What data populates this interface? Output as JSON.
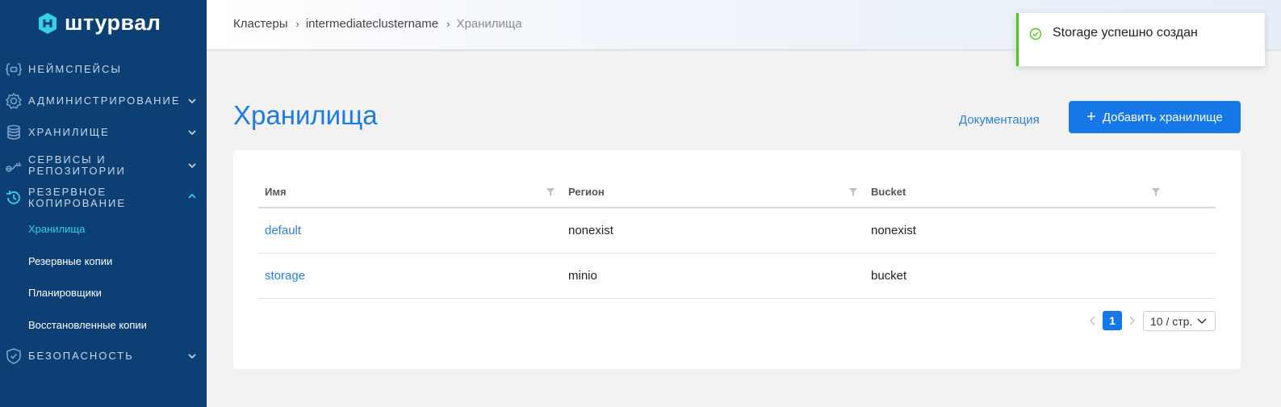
{
  "brand": {
    "name": "штурвал"
  },
  "sidebar": {
    "items": [
      {
        "label": "Неймспейсы",
        "icon": "namespace-icon",
        "chevron": false
      },
      {
        "label": "Администрирование",
        "icon": "gear-icon",
        "chevron": true
      },
      {
        "label": "Хранилище",
        "icon": "database-icon",
        "chevron": true
      },
      {
        "label": "Сервисы и репозитории",
        "icon": "key-icon",
        "chevron": true
      },
      {
        "label": "Резервное копирование",
        "icon": "history-icon",
        "chevron": true,
        "expanded": true
      },
      {
        "label": "Безопасность",
        "icon": "shield-icon",
        "chevron": true
      }
    ],
    "subitems": [
      {
        "label": "Хранилища",
        "active": true
      },
      {
        "label": "Резервные копии",
        "active": false
      },
      {
        "label": "Планировщики",
        "active": false
      },
      {
        "label": "Восстановленные копии",
        "active": false
      }
    ]
  },
  "breadcrumb": {
    "items": [
      "Кластеры",
      "intermediateclustername",
      "Хранилища"
    ]
  },
  "toast": {
    "message": "Storage успешно создан",
    "type": "success"
  },
  "page": {
    "title": "Хранилища",
    "doc_link": "Документация",
    "add_button": "Добавить хранилище"
  },
  "table": {
    "columns": [
      "Имя",
      "Регион",
      "Bucket"
    ],
    "rows": [
      [
        "default",
        "nonexist",
        "nonexist"
      ],
      [
        "storage",
        "minio",
        "bucket"
      ]
    ]
  },
  "pagination": {
    "current_page": "1",
    "page_size": "10 / стр."
  },
  "colors": {
    "sidebar": "#0c3f73",
    "accent": "#1677e6",
    "active_sub": "#36d0e8",
    "success": "#52c41a"
  }
}
